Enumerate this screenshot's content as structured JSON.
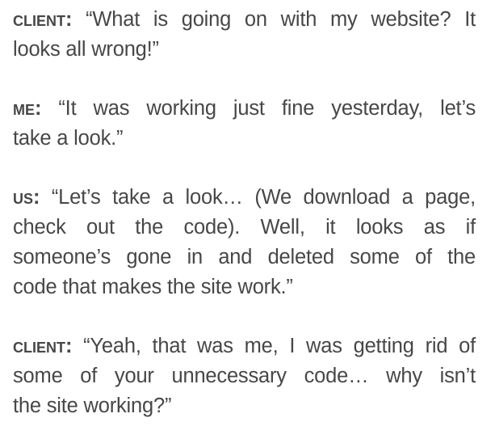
{
  "dialogue": [
    {
      "speaker": "client",
      "colon": ":",
      "lines": [
        "“What is going on with my website? It",
        "looks all wrong!”"
      ]
    },
    {
      "speaker": "me",
      "colon": ":",
      "lines": [
        "“It was working just fine yesterday, let’s",
        "take a look.”"
      ]
    },
    {
      "speaker": "us",
      "colon": ":",
      "lines": [
        "“Let’s take a look… (We download a page,",
        "check out the code). Well, it looks as if",
        "someone’s gone in and deleted some of the",
        "code that makes the site work.”"
      ]
    },
    {
      "speaker": "client",
      "colon": ":",
      "lines": [
        "“Yeah, that was me, I was getting rid of",
        "some of your unnecessary code… why isn’t",
        "the site working?”"
      ]
    }
  ]
}
